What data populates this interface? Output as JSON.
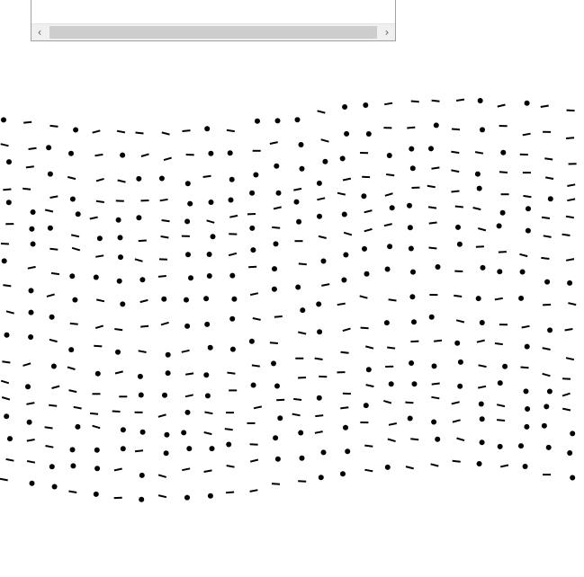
{
  "scroll_panel": {
    "left_arrow_icon": "chevron-left-icon",
    "right_arrow_icon": "chevron-right-icon",
    "left_glyph": "‹",
    "right_glyph": "›"
  },
  "pattern": {
    "description_icon": "dot-dash-pattern",
    "colors": {
      "ink": "#000000",
      "background": "#ffffff"
    }
  }
}
